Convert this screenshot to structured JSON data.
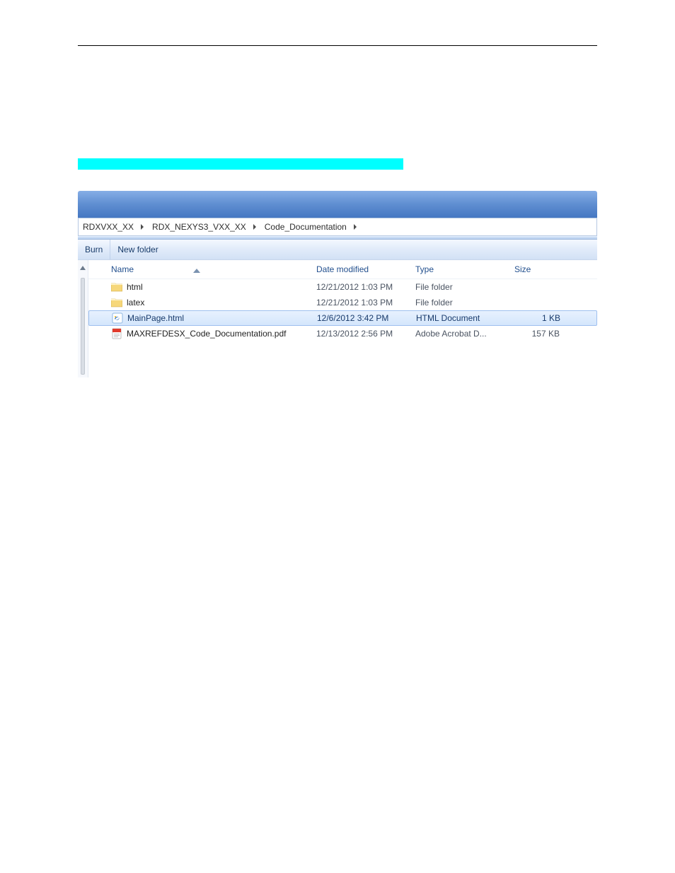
{
  "breadcrumb": [
    "RDXVXX_XX",
    "RDX_NEXYS3_VXX_XX",
    "Code_Documentation"
  ],
  "commands": {
    "burn": "Burn",
    "new_folder": "New folder"
  },
  "columns": {
    "name": "Name",
    "date": "Date modified",
    "type": "Type",
    "size": "Size"
  },
  "files": [
    {
      "name": "html",
      "date": "12/21/2012 1:03 PM",
      "type": "File folder",
      "size": ""
    },
    {
      "name": "latex",
      "date": "12/21/2012 1:03 PM",
      "type": "File folder",
      "size": ""
    },
    {
      "name": "MainPage.html",
      "date": "12/6/2012 3:42 PM",
      "type": "HTML Document",
      "size": "1 KB"
    },
    {
      "name": "MAXREFDESX_Code_Documentation.pdf",
      "date": "12/13/2012 2:56 PM",
      "type": "Adobe Acrobat D...",
      "size": "157 KB"
    }
  ]
}
